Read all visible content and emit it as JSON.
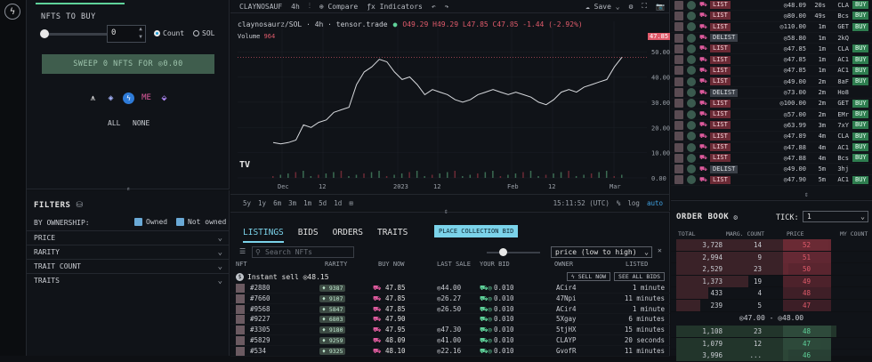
{
  "left": {
    "nfts_to_buy_label": "NFTS TO BUY",
    "qty_value": "0",
    "mode_count": "Count",
    "mode_sol": "SOL",
    "sweep_label": "SWEEP 0 NFTS FOR ◎0.00",
    "all_label": "ALL",
    "none_label": "NONE",
    "filters_title": "FILTERS",
    "by_ownership": "BY OWNERSHIP:",
    "owned": "Owned",
    "not_owned": "Not owned",
    "filters": [
      "PRICE",
      "RARITY",
      "TRAIT COUNT",
      "TRAITS"
    ]
  },
  "chart": {
    "symbol": "CLAYNOSAUF",
    "interval": "4h",
    "compare": "Compare",
    "indicators": "Indicators",
    "save": "Save",
    "legend_name": "claynosaurz/SOL · 4h · tensor.trade",
    "ohlc": "O49.29 H49.29 L47.85 C47.85 -1.44 (-2.92%)",
    "volume_label": "Volume",
    "volume_value": "964",
    "last_price": "47.85",
    "y_ticks": [
      "50.00",
      "40.00",
      "30.00",
      "20.00",
      "10.00",
      "0.00"
    ],
    "x_ticks": [
      "Dec",
      "12",
      "2023",
      "12",
      "Feb",
      "12",
      "Mar"
    ],
    "ranges": [
      "5y",
      "1y",
      "6m",
      "3m",
      "1m",
      "5d",
      "1d"
    ],
    "time": "15:11:52 (UTC)",
    "pct": "%",
    "log": "log",
    "auto": "auto",
    "chart_data": {
      "type": "line",
      "title": "claynosaurz/SOL · 4h · tensor.trade",
      "xlabel": "",
      "ylabel": "",
      "x": [
        "Dec",
        "12",
        "2023",
        "12",
        "Feb",
        "12",
        "Mar"
      ],
      "values": [
        14,
        13.5,
        14,
        15,
        21,
        20,
        22,
        23,
        26,
        27,
        28,
        37,
        42,
        44,
        47,
        46,
        42,
        39,
        40,
        37,
        33,
        35,
        34,
        33,
        31,
        30,
        31,
        33,
        34,
        35,
        34,
        33,
        34,
        33,
        32,
        30,
        29,
        31,
        34,
        35,
        34,
        36,
        37,
        38,
        39,
        44,
        47.85
      ],
      "ylim": [
        0,
        55
      ]
    }
  },
  "feed": [
    {
      "type": "LIST",
      "price": "◎48.09",
      "age": "20s",
      "who": "CLA",
      "action": "BUY"
    },
    {
      "type": "LIST",
      "price": "◎80.00",
      "age": "49s",
      "who": "Bcs",
      "action": "BUY"
    },
    {
      "type": "LIST",
      "price": "◎110.00",
      "age": "1m",
      "who": "GET",
      "action": "BUY"
    },
    {
      "type": "DELIST",
      "price": "◎58.80",
      "age": "1m",
      "who": "2kQ",
      "action": ""
    },
    {
      "type": "LIST",
      "price": "◎47.85",
      "age": "1m",
      "who": "CLA",
      "action": "BUY"
    },
    {
      "type": "LIST",
      "price": "◎47.85",
      "age": "1m",
      "who": "AC1",
      "action": "BUY"
    },
    {
      "type": "LIST",
      "price": "◎47.85",
      "age": "1m",
      "who": "AC1",
      "action": "BUY"
    },
    {
      "type": "LIST",
      "price": "◎49.00",
      "age": "2m",
      "who": "8aF",
      "action": "BUY"
    },
    {
      "type": "DELIST",
      "price": "◎73.00",
      "age": "2m",
      "who": "Ho8",
      "action": ""
    },
    {
      "type": "LIST",
      "price": "◎100.00",
      "age": "2m",
      "who": "GET",
      "action": "BUY"
    },
    {
      "type": "LIST",
      "price": "◎57.00",
      "age": "2m",
      "who": "EMr",
      "action": "BUY"
    },
    {
      "type": "LIST",
      "price": "◎63.99",
      "age": "3m",
      "who": "7xY",
      "action": "BUY"
    },
    {
      "type": "LIST",
      "price": "◎47.89",
      "age": "4m",
      "who": "CLA",
      "action": "BUY"
    },
    {
      "type": "LIST",
      "price": "◎47.88",
      "age": "4m",
      "who": "AC1",
      "action": "BUY"
    },
    {
      "type": "LIST",
      "price": "◎47.88",
      "age": "4m",
      "who": "Bcs",
      "action": "BUY"
    },
    {
      "type": "DELIST",
      "price": "◎49.00",
      "age": "5m",
      "who": "3hj",
      "action": ""
    },
    {
      "type": "LIST",
      "price": "◎47.90",
      "age": "5m",
      "who": "AC1",
      "action": "BUY"
    }
  ],
  "tabs": [
    "LISTINGS",
    "BIDS",
    "ORDERS",
    "TRAITS"
  ],
  "place_bid": "PLACE COLLECTION BID",
  "search_placeholder": "Search NFTs",
  "sort_value": "price (low to high)",
  "columns": [
    "NFT",
    "RARITY",
    "BUY NOW",
    "LAST SALE",
    "YOUR BID",
    "OWNER",
    "LISTED"
  ],
  "instant_sell": "Instant sell ◎48.15",
  "sell_now": "SELL NOW",
  "see_all_bids": "SEE ALL BIDS",
  "listings": [
    {
      "nft": "#2880",
      "rarity": "9387",
      "buy": "47.85",
      "last": "◎44.00",
      "bid": "0.010",
      "owner": "ACir4",
      "listed": "1 minute"
    },
    {
      "nft": "#7660",
      "rarity": "9107",
      "buy": "47.85",
      "last": "◎26.27",
      "bid": "0.010",
      "owner": "47Npi",
      "listed": "11 minutes"
    },
    {
      "nft": "#9568",
      "rarity": "5847",
      "buy": "47.85",
      "last": "◎26.50",
      "bid": "0.010",
      "owner": "ACir4",
      "listed": "1 minute"
    },
    {
      "nft": "#9227",
      "rarity": "6803",
      "buy": "47.90",
      "last": "",
      "bid": "0.010",
      "owner": "5Xgay",
      "listed": "6 minutes"
    },
    {
      "nft": "#3305",
      "rarity": "9180",
      "buy": "47.95",
      "last": "◎47.30",
      "bid": "0.010",
      "owner": "5tjHX",
      "listed": "15 minutes"
    },
    {
      "nft": "#5829",
      "rarity": "9259",
      "buy": "48.09",
      "last": "◎41.00",
      "bid": "0.010",
      "owner": "CLAYP",
      "listed": "20 seconds"
    },
    {
      "nft": "#534",
      "rarity": "9325",
      "buy": "48.10",
      "last": "◎22.16",
      "bid": "0.010",
      "owner": "GvofR",
      "listed": "11 minutes"
    }
  ],
  "orderbook": {
    "title": "ORDER BOOK",
    "tick_label": "TICK:",
    "tick_value": "1",
    "cols": [
      "TOTAL",
      "MARG. COUNT",
      "PRICE",
      "MY COUNT"
    ],
    "asks": [
      {
        "total": "3,728",
        "count": "14",
        "price": "52",
        "depth": 0.95
      },
      {
        "total": "2,994",
        "count": "9",
        "price": "51",
        "depth": 0.8
      },
      {
        "total": "2,529",
        "count": "23",
        "price": "50",
        "depth": 0.7
      },
      {
        "total": "1,373",
        "count": "19",
        "price": "49",
        "depth": 0.45
      },
      {
        "total": "433",
        "count": "4",
        "price": "48",
        "depth": 0.2
      },
      {
        "total": "239",
        "count": "5",
        "price": "47",
        "depth": 0.15
      }
    ],
    "spread": "◎47.00 - ◎48.00",
    "bids": [
      {
        "total": "1,108",
        "count": "23",
        "price": "48",
        "depth": 1.0
      },
      {
        "total": "1,079",
        "count": "12",
        "price": "47",
        "depth": 0.9
      },
      {
        "total": "3,996",
        "count": "...",
        "price": "46",
        "depth": 0.7
      }
    ]
  }
}
